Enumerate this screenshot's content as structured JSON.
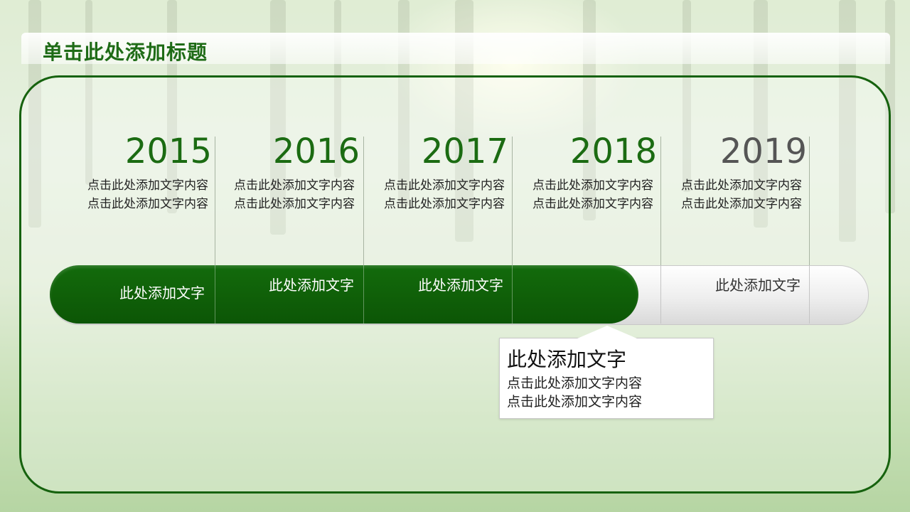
{
  "slide": {
    "title": "单击此处添加标题"
  },
  "timeline": {
    "years": [
      {
        "year": "2015",
        "desc_line1": "点击此处添加文字内容",
        "desc_line2": "点击此处添加文字内容",
        "bar_label": "此处添加文字"
      },
      {
        "year": "2016",
        "desc_line1": "点击此处添加文字内容",
        "desc_line2": "点击此处添加文字内容",
        "bar_label": "此处添加文字"
      },
      {
        "year": "2017",
        "desc_line1": "点击此处添加文字内容",
        "desc_line2": "点击此处添加文字内容",
        "bar_label": "此处添加文字"
      },
      {
        "year": "2018",
        "desc_line1": "点击此处添加文字内容",
        "desc_line2": "点击此处添加文字内容",
        "bar_label": ""
      },
      {
        "year": "2019",
        "desc_line1": "点击此处添加文字内容",
        "desc_line2": "点击此处添加文字内容",
        "bar_label": "此处添加文字"
      }
    ],
    "callout": {
      "title": "此处添加文字",
      "line1": "点击此处添加文字内容",
      "line2": "点击此处添加文字内容"
    }
  },
  "colors": {
    "accent_green": "#16620e",
    "future_gray": "#555555"
  }
}
